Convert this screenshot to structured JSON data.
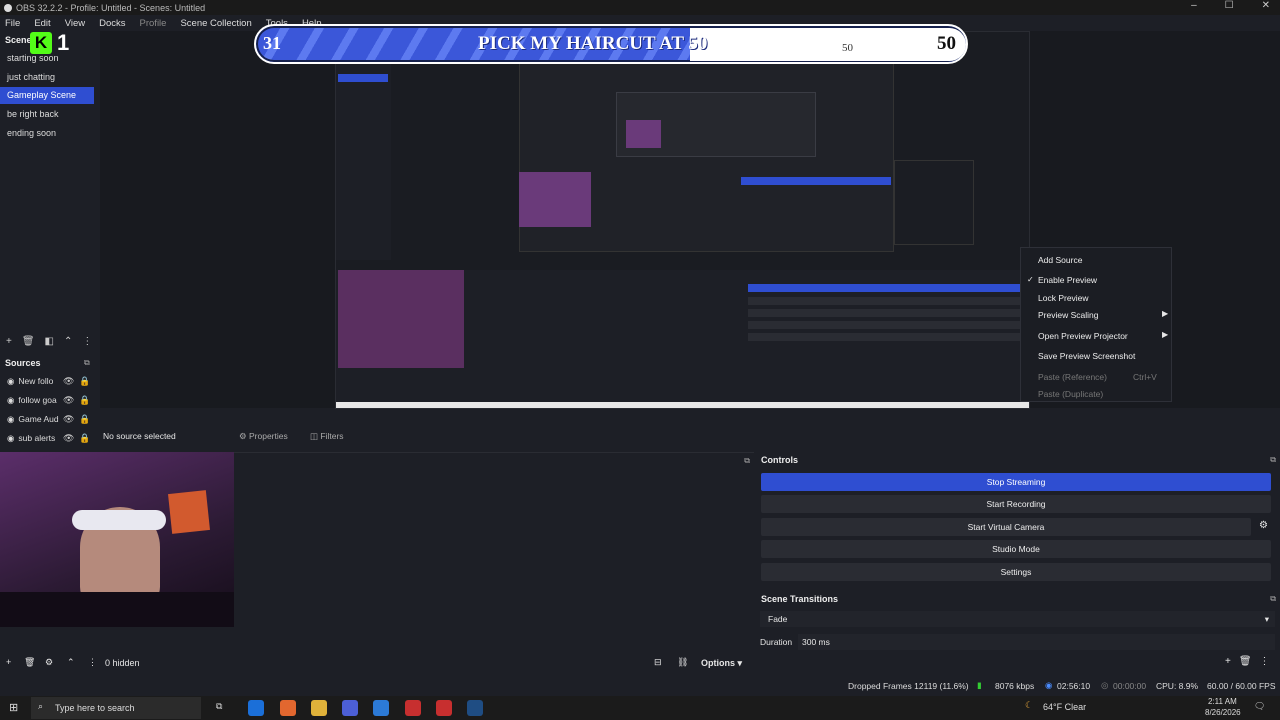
{
  "window": {
    "title": "OBS 32.2.2 - Profile: Untitled - Scenes: Untitled",
    "controls": [
      "–",
      "☐",
      "✕"
    ]
  },
  "menu": [
    "File",
    "Edit",
    "View",
    "Docks",
    "Profile",
    "Scene Collection",
    "Tools",
    "Help"
  ],
  "overlay": {
    "kick_count": "1",
    "banner_left": "31",
    "banner_title": "PICK MY HAIRCUT AT 50",
    "banner_mini": "50",
    "banner_right": "50"
  },
  "scenes": {
    "title": "Scenes",
    "items": [
      {
        "label": "starting soon",
        "selected": false
      },
      {
        "label": "just chatting",
        "selected": false
      },
      {
        "label": "Gameplay Scene",
        "selected": true
      },
      {
        "label": "be right back",
        "selected": false
      },
      {
        "label": "ending soon",
        "selected": false
      }
    ]
  },
  "sources": {
    "title": "Sources",
    "items": [
      "New follo",
      "follow goa",
      "Game Aud",
      "sub alerts"
    ],
    "hidden_label": "0 hidden"
  },
  "context_menu": {
    "items": [
      {
        "label": "Add Source",
        "checked": false,
        "submenu": false,
        "disabled": false
      },
      {
        "label": "Enable Preview",
        "checked": true,
        "submenu": false,
        "disabled": false
      },
      {
        "label": "Lock Preview",
        "checked": false,
        "submenu": false,
        "disabled": false
      },
      {
        "label": "Preview Scaling",
        "checked": false,
        "submenu": true,
        "disabled": false
      },
      {
        "label": "Open Preview Projector",
        "checked": false,
        "submenu": true,
        "disabled": false
      },
      {
        "label": "Save Preview Screenshot",
        "checked": false,
        "submenu": false,
        "disabled": false
      },
      {
        "label": "Paste (Reference)",
        "shortcut": "Ctrl+V",
        "disabled": true
      },
      {
        "label": "Paste (Duplicate)",
        "disabled": true
      }
    ]
  },
  "source_toolbar": {
    "no_source": "No source selected",
    "properties": "Properties",
    "filters": "Filters"
  },
  "controls": {
    "title": "Controls",
    "buttons": [
      "Stop Streaming",
      "Start Recording",
      "Start Virtual Camera",
      "Studio Mode",
      "Settings"
    ]
  },
  "transitions": {
    "title": "Scene Transitions",
    "type": "Fade",
    "duration_label": "Duration",
    "duration_value": "300 ms"
  },
  "mixer": {
    "options_label": "Options"
  },
  "status": {
    "dropped_frames": "Dropped Frames 12119 (11.6%)",
    "bitrate": "8076 kbps",
    "stream_time": "02:56:10",
    "rec_time": "00:00:00",
    "cpu": "CPU: 8.9%",
    "fps": "60.00 / 60.00 FPS"
  },
  "taskbar": {
    "search_placeholder": "Type here to search",
    "weather": "64°F  Clear",
    "time": "2:11 AM",
    "date": "8/26/2026"
  },
  "colors": {
    "accent": "#2f4ed1",
    "panel": "#1d1f26",
    "kick_green": "#53fc18"
  }
}
